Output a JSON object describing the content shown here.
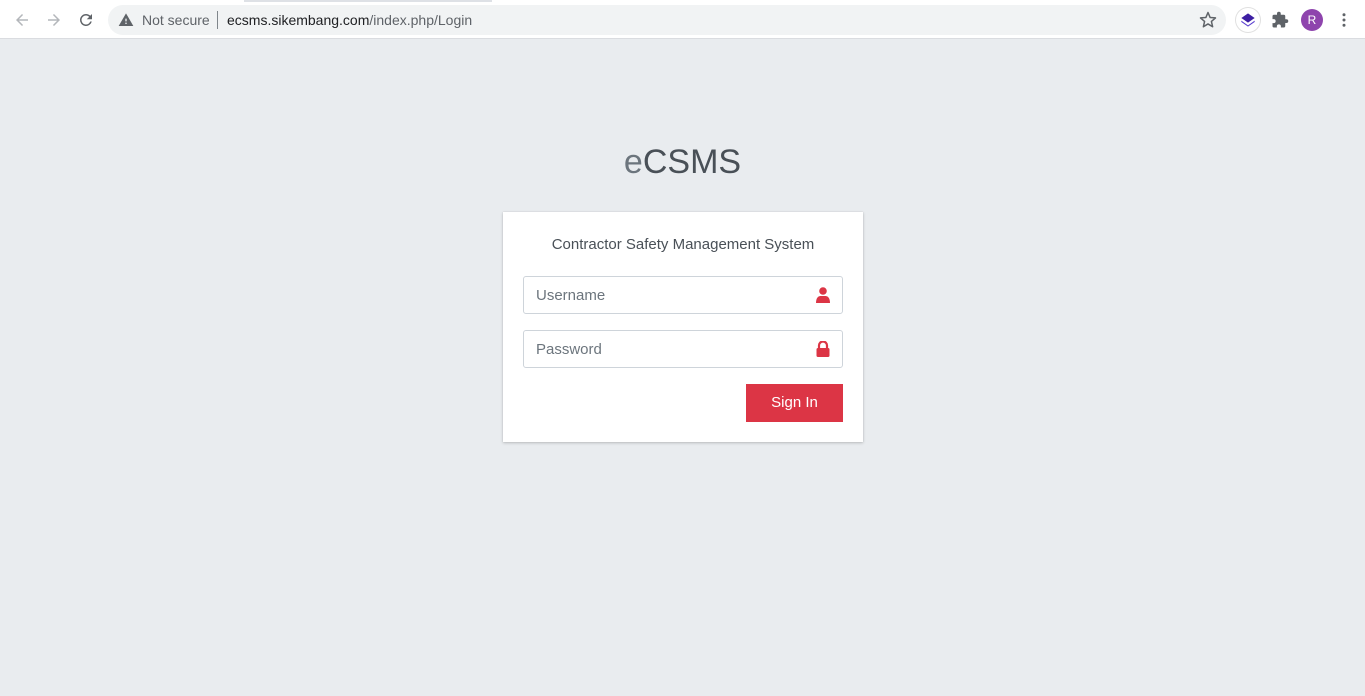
{
  "browser": {
    "security_label": "Not secure",
    "url_host": "ecsms.sikembang.com",
    "url_path": "/index.php/Login",
    "avatar_initial": "R"
  },
  "login": {
    "logo_prefix": "e",
    "logo_main": "CSMS",
    "subtitle": "Contractor Safety Management System",
    "username_placeholder": "Username",
    "password_placeholder": "Password",
    "signin_label": "Sign In"
  },
  "colors": {
    "page_background": "#e9ecef",
    "accent": "#dc3545",
    "avatar": "#8e44ad"
  },
  "icons": {
    "back": "arrow-left-icon",
    "forward": "arrow-right-icon",
    "reload": "reload-icon",
    "security": "warning-triangle-icon",
    "bookmark": "star-icon",
    "extension": "shield-extension-icon",
    "extensions_menu": "puzzle-icon",
    "menu": "kebab-menu-icon",
    "username": "user-icon",
    "password": "lock-icon"
  }
}
